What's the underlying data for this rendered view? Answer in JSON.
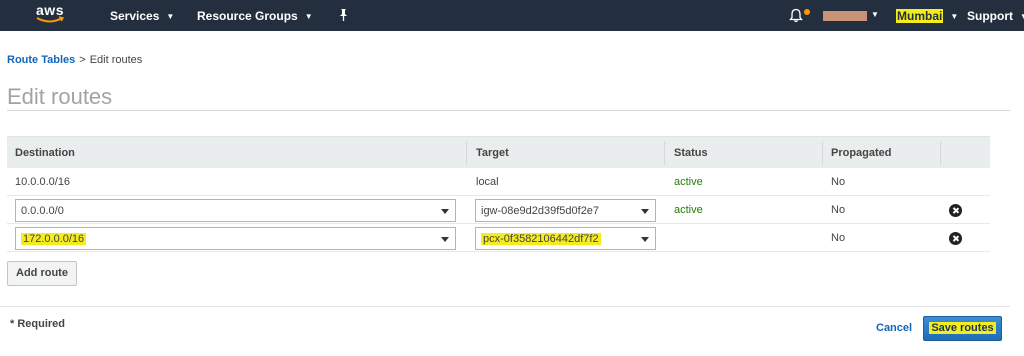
{
  "nav": {
    "logo_text": "aws",
    "services_label": "Services",
    "resource_groups_label": "Resource Groups",
    "region_label": "Mumbai",
    "support_label": "Support"
  },
  "breadcrumb": {
    "parent_label": "Route Tables",
    "separator": ">",
    "current_label": "Edit routes"
  },
  "page": {
    "title": "Edit routes"
  },
  "table": {
    "headers": {
      "destination": "Destination",
      "target": "Target",
      "status": "Status",
      "propagated": "Propagated"
    },
    "rows": [
      {
        "destination": "10.0.0.0/16",
        "target": "local",
        "status": "active",
        "propagated": "No",
        "editable": false
      },
      {
        "destination": "0.0.0.0/0",
        "target": "igw-08e9d2d39f5d0f2e7",
        "status": "active",
        "propagated": "No",
        "editable": true
      },
      {
        "destination": "172.0.0.0/16",
        "target": "pcx-0f3582106442df7f2",
        "status": "",
        "propagated": "No",
        "editable": true,
        "highlighted": true
      }
    ]
  },
  "actions": {
    "add_route_label": "Add route",
    "required_label": "* Required",
    "cancel_label": "Cancel",
    "save_label": "Save routes"
  },
  "colors": {
    "nav_bg": "#232f3e",
    "link": "#1166bb",
    "status_active": "#1d8102",
    "highlight": "#f4ec1e",
    "primary_button": "#1f6bb5",
    "notification_dot": "#ff9900"
  },
  "icons": [
    "aws-logo",
    "chevron-down-icon",
    "pin-icon",
    "bell-icon",
    "remove-icon",
    "dropdown-arrow-icon"
  ]
}
